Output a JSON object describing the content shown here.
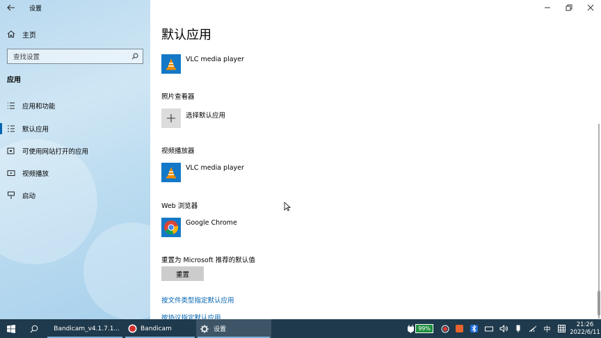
{
  "window": {
    "title": "设置"
  },
  "sidebar": {
    "home_label": "主页",
    "search_placeholder": "查找设置",
    "section_title": "应用",
    "items": [
      {
        "label": "应用和功能",
        "icon": "list-icon"
      },
      {
        "label": "默认应用",
        "icon": "default-apps-icon",
        "active": true
      },
      {
        "label": "可使用网站打开的应用",
        "icon": "web-apps-icon"
      },
      {
        "label": "视频播放",
        "icon": "video-icon"
      },
      {
        "label": "启动",
        "icon": "startup-icon"
      }
    ]
  },
  "main": {
    "title": "默认应用",
    "top_app": "VLC media player",
    "photo": {
      "category": "照片查看器",
      "app": "选择默认应用"
    },
    "video": {
      "category": "视频播放器",
      "app": "VLC media player"
    },
    "web": {
      "category": "Web 浏览器",
      "app": "Google Chrome"
    },
    "reset": {
      "label": "重置为 Microsoft 推荐的默认值",
      "button": "重置"
    },
    "links": {
      "by_file_type": "按文件类型指定默认应用",
      "by_protocol": "按协议指定默认应用"
    }
  },
  "taskbar": {
    "tasks": [
      {
        "label": "Bandicam_v4.1.7.1...",
        "icon": "folder-icon"
      },
      {
        "label": "Bandicam",
        "icon": "record-icon"
      },
      {
        "label": "设置",
        "icon": "gear-icon"
      }
    ],
    "battery": "99%",
    "ime": "中",
    "time": "21:26",
    "date": "2022/6/11"
  },
  "colors": {
    "accent": "#0063b1",
    "taskbar": "#1f3a4c",
    "vlc_tile": "#1478c8"
  }
}
